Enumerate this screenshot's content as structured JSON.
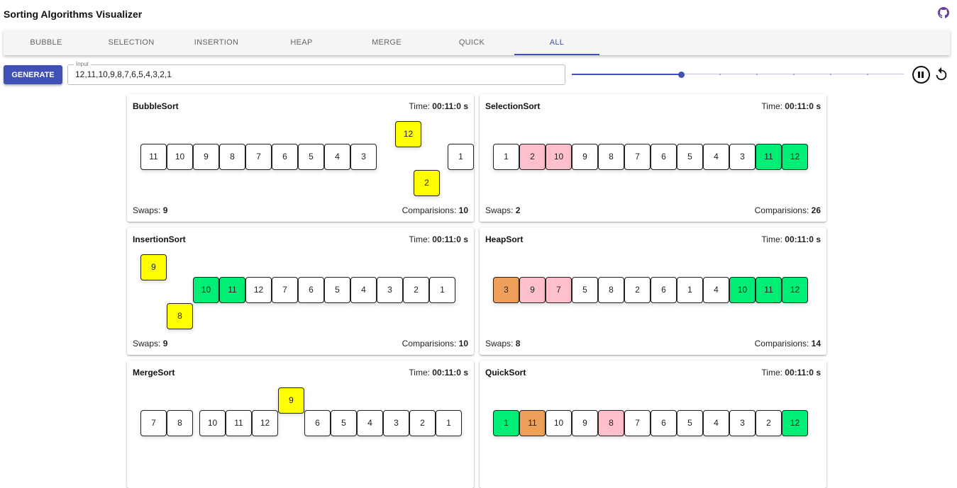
{
  "app": {
    "title": "Sorting Algorithms Visualizer",
    "github_icon": "github-icon"
  },
  "tabs": [
    {
      "label": "BUBBLE",
      "active": false
    },
    {
      "label": "SELECTION",
      "active": false
    },
    {
      "label": "INSERTION",
      "active": false
    },
    {
      "label": "HEAP",
      "active": false
    },
    {
      "label": "MERGE",
      "active": false
    },
    {
      "label": "QUICK",
      "active": false
    },
    {
      "label": "ALL",
      "active": true
    }
  ],
  "controls": {
    "generate_label": "GENERATE",
    "input_legend": "Input",
    "input_value": "12,11,10,9,8,7,6,5,4,3,2,1",
    "speed_fraction": 0.33,
    "pause_icon": "pause-circle-icon",
    "reset_icon": "reset-icon"
  },
  "colors": {
    "primary": "#3f51b5",
    "white": "#ffffff",
    "yellow": "#ffff00",
    "green": "#00ee76",
    "pink": "#ffc0cb",
    "orange": "#eea05a"
  },
  "labels": {
    "time": "Time: ",
    "swaps": "Swaps: ",
    "comparisons": "Comparisions: "
  },
  "cards": [
    {
      "name": "BubbleSort",
      "time": "00:11:0 s",
      "swaps": "9",
      "comparisons": "10",
      "cells": [
        {
          "v": "11",
          "c": "white"
        },
        {
          "v": "10",
          "c": "white"
        },
        {
          "v": "9",
          "c": "white"
        },
        {
          "v": "8",
          "c": "white"
        },
        {
          "v": "7",
          "c": "white"
        },
        {
          "v": "6",
          "c": "white"
        },
        {
          "v": "5",
          "c": "white"
        },
        {
          "v": "4",
          "c": "white"
        },
        {
          "v": "3",
          "c": "white"
        },
        {
          "v": "12",
          "c": "yellow",
          "lift": "up",
          "slot": 9.7
        },
        {
          "v": "2",
          "c": "yellow",
          "lift": "down",
          "slot": 10.4
        },
        {
          "v": "1",
          "c": "white",
          "slot": 11.7
        }
      ]
    },
    {
      "name": "SelectionSort",
      "time": "00:11:0 s",
      "swaps": "2",
      "comparisons": "26",
      "cells": [
        {
          "v": "1",
          "c": "white"
        },
        {
          "v": "2",
          "c": "pink"
        },
        {
          "v": "10",
          "c": "pink"
        },
        {
          "v": "9",
          "c": "white"
        },
        {
          "v": "8",
          "c": "white"
        },
        {
          "v": "7",
          "c": "white"
        },
        {
          "v": "6",
          "c": "white"
        },
        {
          "v": "5",
          "c": "white"
        },
        {
          "v": "4",
          "c": "white"
        },
        {
          "v": "3",
          "c": "white"
        },
        {
          "v": "11",
          "c": "green"
        },
        {
          "v": "12",
          "c": "green"
        }
      ]
    },
    {
      "name": "InsertionSort",
      "time": "00:11:0 s",
      "swaps": "9",
      "comparisons": "10",
      "cells": [
        {
          "v": "9",
          "c": "yellow",
          "lift": "up",
          "slot": 0
        },
        {
          "v": "8",
          "c": "yellow",
          "lift": "down",
          "slot": 1
        },
        {
          "v": "10",
          "c": "green",
          "slot": 2
        },
        {
          "v": "11",
          "c": "green",
          "slot": 3
        },
        {
          "v": "12",
          "c": "white",
          "slot": 4
        },
        {
          "v": "7",
          "c": "white",
          "slot": 5
        },
        {
          "v": "6",
          "c": "white",
          "slot": 6
        },
        {
          "v": "5",
          "c": "white",
          "slot": 7
        },
        {
          "v": "4",
          "c": "white",
          "slot": 8
        },
        {
          "v": "3",
          "c": "white",
          "slot": 9
        },
        {
          "v": "2",
          "c": "white",
          "slot": 10
        },
        {
          "v": "1",
          "c": "white",
          "slot": 11
        }
      ]
    },
    {
      "name": "HeapSort",
      "time": "00:11:0 s",
      "swaps": "8",
      "comparisons": "14",
      "cells": [
        {
          "v": "3",
          "c": "orange"
        },
        {
          "v": "9",
          "c": "pink"
        },
        {
          "v": "7",
          "c": "pink"
        },
        {
          "v": "5",
          "c": "white"
        },
        {
          "v": "8",
          "c": "white"
        },
        {
          "v": "2",
          "c": "white"
        },
        {
          "v": "6",
          "c": "white"
        },
        {
          "v": "1",
          "c": "white"
        },
        {
          "v": "4",
          "c": "white"
        },
        {
          "v": "10",
          "c": "green"
        },
        {
          "v": "11",
          "c": "green"
        },
        {
          "v": "12",
          "c": "green"
        }
      ]
    },
    {
      "name": "MergeSort",
      "time": "00:11:0 s",
      "swaps": "",
      "comparisons": "",
      "cells": [
        {
          "v": "7",
          "c": "white",
          "slot": 0
        },
        {
          "v": "8",
          "c": "white",
          "slot": 1
        },
        {
          "v": "10",
          "c": "white",
          "slot": 2.25
        },
        {
          "v": "11",
          "c": "white",
          "slot": 3.25
        },
        {
          "v": "12",
          "c": "white",
          "slot": 4.25
        },
        {
          "v": "9",
          "c": "yellow",
          "lift": "up",
          "slot": 5.25
        },
        {
          "v": "6",
          "c": "white",
          "slot": 6.25
        },
        {
          "v": "5",
          "c": "white",
          "slot": 7.25
        },
        {
          "v": "4",
          "c": "white",
          "slot": 8.25
        },
        {
          "v": "3",
          "c": "white",
          "slot": 9.25
        },
        {
          "v": "2",
          "c": "white",
          "slot": 10.25
        },
        {
          "v": "1",
          "c": "white",
          "slot": 11.25
        }
      ]
    },
    {
      "name": "QuickSort",
      "time": "00:11:0 s",
      "swaps": "",
      "comparisons": "",
      "cells": [
        {
          "v": "1",
          "c": "green"
        },
        {
          "v": "11",
          "c": "orange"
        },
        {
          "v": "10",
          "c": "white"
        },
        {
          "v": "9",
          "c": "white"
        },
        {
          "v": "8",
          "c": "pink"
        },
        {
          "v": "7",
          "c": "white"
        },
        {
          "v": "6",
          "c": "white"
        },
        {
          "v": "5",
          "c": "white"
        },
        {
          "v": "4",
          "c": "white"
        },
        {
          "v": "3",
          "c": "white"
        },
        {
          "v": "2",
          "c": "white"
        },
        {
          "v": "12",
          "c": "green"
        }
      ]
    }
  ]
}
